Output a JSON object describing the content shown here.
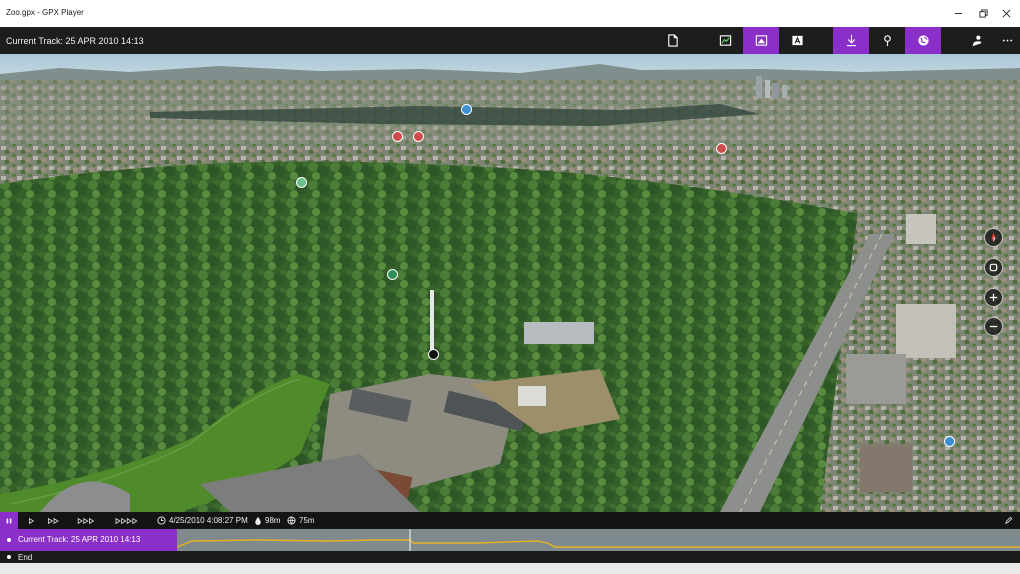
{
  "window": {
    "title": "Zoo.gpx - GPX Player",
    "controls": [
      "minimize",
      "maximize",
      "close"
    ]
  },
  "toolbar": {
    "current_track": "Current Track: 25 APR 2010 14:13",
    "buttons": [
      {
        "name": "open-file",
        "icon": "document-icon",
        "active": false
      },
      {
        "name": "map-view",
        "icon": "map-icon",
        "active": false
      },
      {
        "name": "aerial-view",
        "icon": "aerial-icon",
        "active": true
      },
      {
        "name": "label-view",
        "icon": "labels-icon",
        "active": false
      },
      {
        "name": "download",
        "icon": "download-icon",
        "active": true
      },
      {
        "name": "pushpin",
        "icon": "pushpin-icon",
        "active": false
      },
      {
        "name": "globe",
        "icon": "globe-icon",
        "active": true
      },
      {
        "name": "share",
        "icon": "share-icon",
        "active": false
      },
      {
        "name": "more",
        "icon": "more-icon",
        "active": false
      }
    ],
    "accent_color": "#8b2fc9"
  },
  "map": {
    "view": "3D aerial city view",
    "controls": [
      "compass-icon",
      "tilt-icon",
      "zoom-in-icon",
      "zoom-out-icon"
    ]
  },
  "playbar": {
    "speed_buttons": [
      "play",
      "fast",
      "faster",
      "fastest"
    ],
    "datetime": "4/25/2010 4:08:27 PM",
    "elevation": "98m",
    "distance": "75m"
  },
  "timeline": {
    "tracks": [
      {
        "label": "Current Track: 25 APR 2010 14:13",
        "selected": true
      },
      {
        "label": "End",
        "selected": false
      }
    ]
  }
}
